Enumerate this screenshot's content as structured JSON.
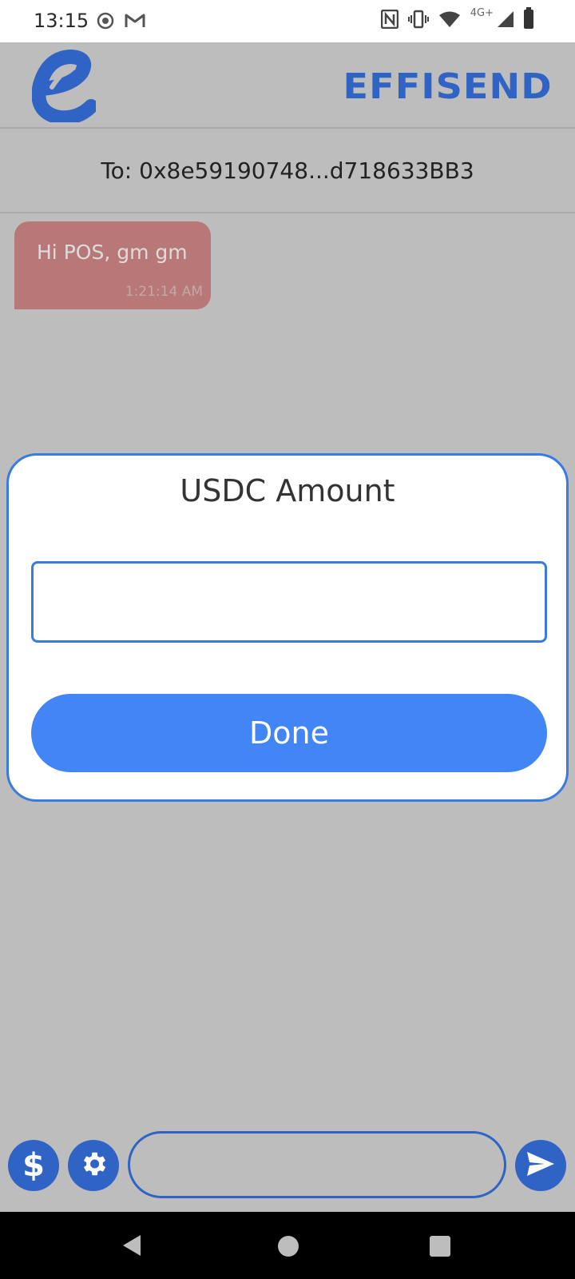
{
  "status_bar": {
    "time": "13:15",
    "network": "4G+",
    "left_icons": [
      "record-icon",
      "gmail-icon"
    ],
    "right_icons": [
      "nfc-icon",
      "vibrate-icon",
      "wifi-icon",
      "signal-icon",
      "battery-icon"
    ]
  },
  "header": {
    "brand": "EFFISEND",
    "logo_letter": "e",
    "brand_color": "#2f63c4"
  },
  "recipient": {
    "text": "To: 0x8e59190748...d718633BB3"
  },
  "messages": [
    {
      "text": "Hi POS, gm gm",
      "time": "1:21:14 AM",
      "bubble_color": "#b97878"
    }
  ],
  "modal": {
    "title": "USDC Amount",
    "input_value": "",
    "done_label": "Done",
    "accent_color": "#4285f4"
  },
  "composer": {
    "dollar_label": "$",
    "message_value": ""
  },
  "nav": {
    "icons": [
      "back-icon",
      "home-icon",
      "recents-icon"
    ]
  }
}
